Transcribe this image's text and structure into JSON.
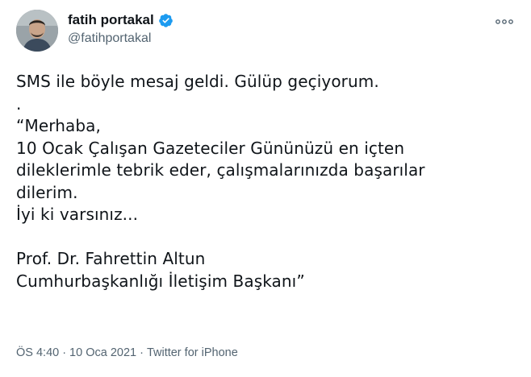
{
  "author": {
    "display_name": "fatih portakal",
    "handle": "@fatihportakal",
    "verified": true,
    "verified_color": "#1d9bf0"
  },
  "menu": {
    "icon": "more-dots-icon"
  },
  "tweet": {
    "lines": [
      "SMS ile böyle mesaj geldi. Gülüp geçiyorum.",
      ".",
      "“Merhaba,",
      "10 Ocak Çalışan Gazeteciler Gününüzü en içten",
      "dileklerimle tebrik eder, çalışmalarınızda başarılar",
      "dilerim.",
      "İyi ki varsınız...",
      "",
      "Prof. Dr. Fahrettin Altun",
      "Cumhurbaşkanlığı İletişim Başkanı”"
    ]
  },
  "meta": {
    "time": "ÖS 4:40",
    "separator": "·",
    "date": "10 Oca 2021",
    "source": "Twitter for iPhone"
  },
  "colors": {
    "text": "#0f1419",
    "secondary": "#536471",
    "background": "#ffffff"
  }
}
